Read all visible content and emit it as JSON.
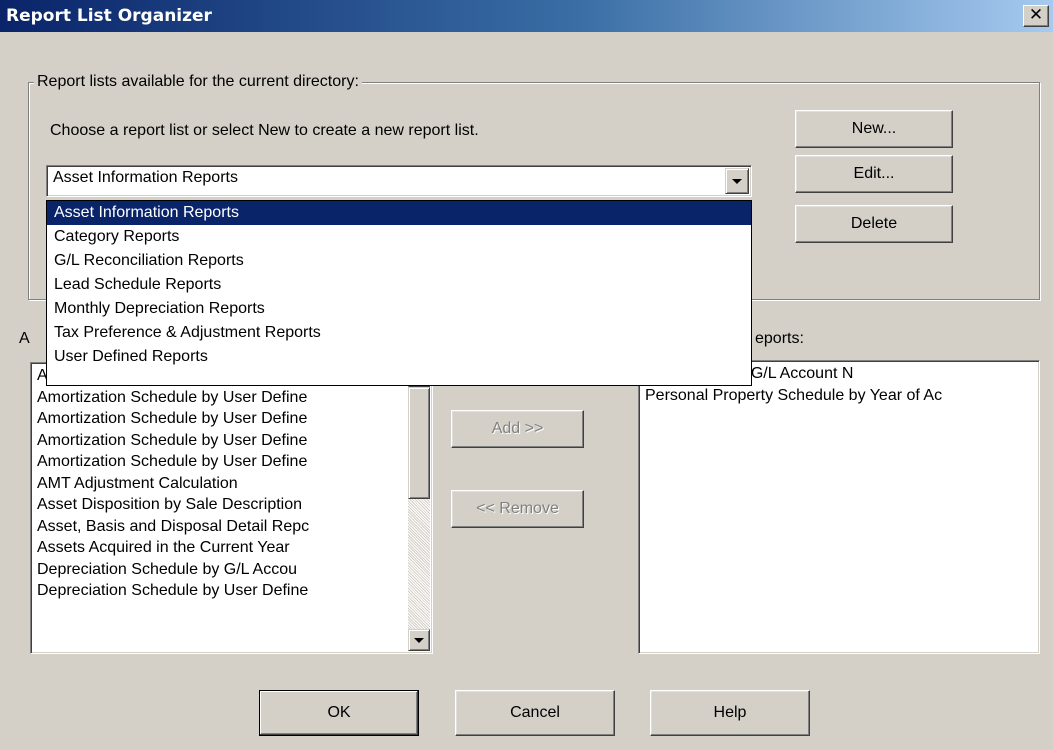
{
  "window": {
    "title": "Report List Organizer",
    "close_glyph": "✕"
  },
  "group": {
    "legend": "Report lists available for the current directory:",
    "instruction": "Choose a report list or select New to create a new report list."
  },
  "combo": {
    "selected": "Asset Information Reports"
  },
  "dropdown": {
    "options": [
      "Asset Information Reports",
      "Category Reports",
      "G/L Reconciliation Reports",
      "Lead Schedule Reports",
      "Monthly Depreciation Reports",
      "Tax Preference & Adjustment Reports",
      "User Defined Reports"
    ],
    "selected_index": 0
  },
  "buttons": {
    "new": "New...",
    "edit": "Edit...",
    "delete": "Delete",
    "add": "Add >>",
    "remove": "<< Remove",
    "ok": "OK",
    "cancel": "Cancel",
    "help": "Help"
  },
  "available": {
    "label_partial": "A",
    "items": [
      "A",
      "Amortization Schedule by User Define",
      "Amortization Schedule by User Define",
      "Amortization Schedule by User Define",
      "Amortization Schedule by User Define",
      "AMT Adjustment Calculation",
      "Asset Disposition by Sale Description",
      "Asset, Basis and Disposal Detail Repc",
      "Assets Acquired in the Current Year",
      "Depreciation Schedule by G/L Accou",
      "Depreciation Schedule by User Define"
    ]
  },
  "selected_reports": {
    "label_partial": "eports:",
    "items": [
      "n Schedule by G/L Account N",
      "Personal Property Schedule by Year of Ac"
    ]
  },
  "icons": {
    "dropdown_arrow": "chevron-down-icon",
    "scroll_up": "scroll-up-icon",
    "scroll_down": "scroll-down-icon",
    "close": "close-icon"
  }
}
